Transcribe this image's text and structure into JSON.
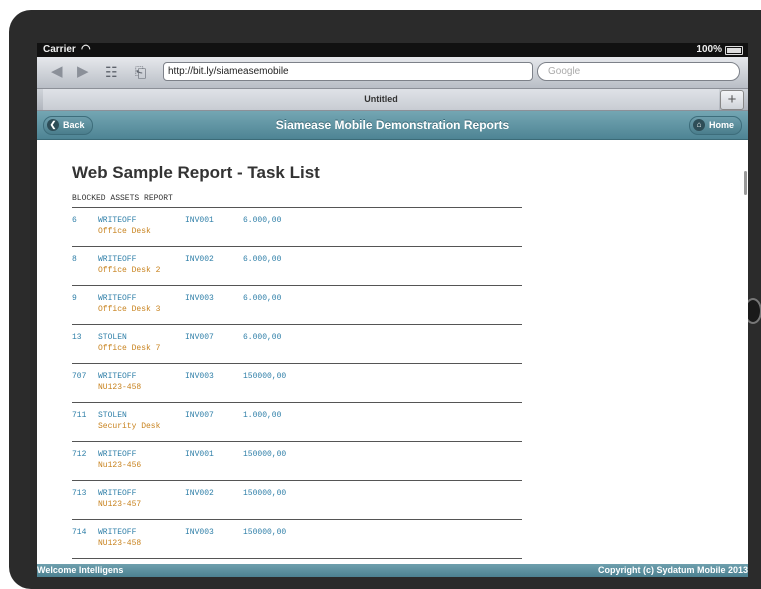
{
  "status": {
    "carrier": "Carrier",
    "battery": "100%"
  },
  "browser": {
    "url": "http://bit.ly/siameasemobile",
    "search_placeholder": "Google",
    "tab_title": "Untitled",
    "newtab_label": "+"
  },
  "appbar": {
    "back": "Back",
    "title": "Siamease Mobile Demonstration Reports",
    "home": "Home"
  },
  "report": {
    "title": "Web Sample Report - Task List",
    "subtitle": "BLOCKED ASSETS REPORT",
    "rows": [
      {
        "id": "6",
        "type": "WRITEOFF",
        "inv": "INV001",
        "amount": "6.000,00",
        "desc": "Office Desk"
      },
      {
        "id": "8",
        "type": "WRITEOFF",
        "inv": "INV002",
        "amount": "6.000,00",
        "desc": "Office Desk 2"
      },
      {
        "id": "9",
        "type": "WRITEOFF",
        "inv": "INV003",
        "amount": "6.000,00",
        "desc": "Office Desk 3"
      },
      {
        "id": "13",
        "type": "STOLEN",
        "inv": "INV007",
        "amount": "6.000,00",
        "desc": "Office Desk 7"
      },
      {
        "id": "707",
        "type": "WRITEOFF",
        "inv": "INV003",
        "amount": "150000,00",
        "desc": "NU123-458"
      },
      {
        "id": "711",
        "type": "STOLEN",
        "inv": "INV007",
        "amount": "1.000,00",
        "desc": "Security Desk"
      },
      {
        "id": "712",
        "type": "WRITEOFF",
        "inv": "INV001",
        "amount": "150000,00",
        "desc": "Nu123-456"
      },
      {
        "id": "713",
        "type": "WRITEOFF",
        "inv": "INV002",
        "amount": "150000,00",
        "desc": "NU123-457"
      },
      {
        "id": "714",
        "type": "WRITEOFF",
        "inv": "INV003",
        "amount": "150000,00",
        "desc": "NU123-458"
      }
    ]
  },
  "footer": {
    "left": "Welcome Intelligens",
    "right": "Copyright (c) Sydatum Mobile 2013"
  },
  "colors": {
    "appbar": "#5b8f9e",
    "id_text": "#2f7fa8",
    "desc_text": "#c8831f"
  }
}
